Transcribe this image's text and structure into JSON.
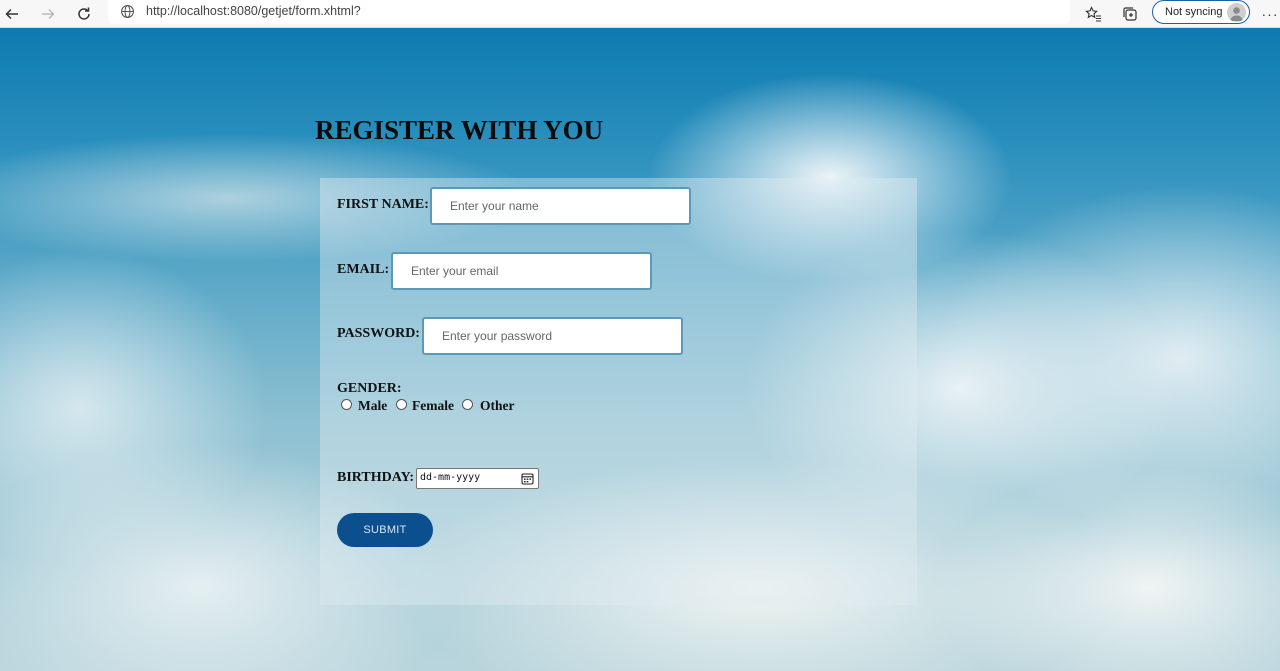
{
  "browser": {
    "url": "http://localhost:8080/getjet/form.xhtml?",
    "sync_label": "Not syncing",
    "more_label": "···"
  },
  "page": {
    "title": "REGISTER WITH YOU"
  },
  "form": {
    "first_name": {
      "label": "FIRST NAME:",
      "placeholder": "Enter your name",
      "value": ""
    },
    "email": {
      "label": "EMAIL:",
      "placeholder": "Enter your email",
      "value": ""
    },
    "password": {
      "label": "PASSWORD:",
      "placeholder": "Enter your password",
      "value": ""
    },
    "gender": {
      "label": "GENDER:",
      "options": [
        {
          "label": "Male"
        },
        {
          "label": "Female"
        },
        {
          "label": "Other"
        }
      ]
    },
    "birthday": {
      "label": "BIRTHDAY:",
      "placeholder": "dd-mm-yyyy"
    },
    "submit_label": "SUBMIT"
  },
  "colors": {
    "submit_bg": "#0b4f8f",
    "field_border": "#5a9ab8",
    "sync_border": "#1a5fa8"
  },
  "icons": [
    "back-icon",
    "forward-icon",
    "reload-icon",
    "globe-icon",
    "favorites-icon",
    "collections-icon",
    "profile-avatar-icon",
    "calendar-icon"
  ]
}
